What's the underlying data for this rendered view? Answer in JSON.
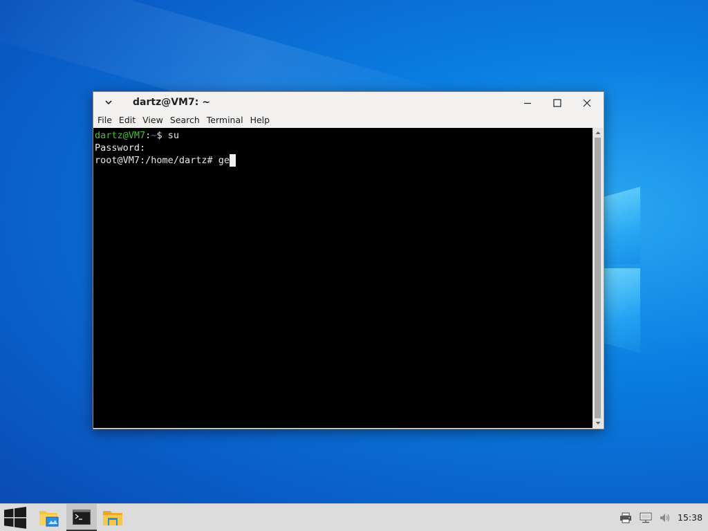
{
  "window": {
    "title": "dartz@VM7: ~",
    "menu": [
      "File",
      "Edit",
      "View",
      "Search",
      "Terminal",
      "Help"
    ]
  },
  "terminal": {
    "prompt_user": "dartz@VM7",
    "prompt_colon": ":",
    "prompt_path": "~",
    "prompt_suffix": "$ su",
    "line2": "Password:",
    "line3": "root@VM7:/home/dartz# ge"
  },
  "taskbar": {
    "apps": [
      "start-menu",
      "file-manager",
      "terminal",
      "file-explorer"
    ],
    "active_app": "terminal",
    "tray_icons": [
      "printer-icon",
      "network-icon",
      "volume-icon"
    ],
    "clock": "15:38"
  },
  "colors": {
    "desktop": "#0a7ee2",
    "prompt_user": "#4bbf3a",
    "prompt_path": "#3c6be8",
    "terminal_bg": "#000000",
    "taskbar": "#dcdcdc"
  }
}
